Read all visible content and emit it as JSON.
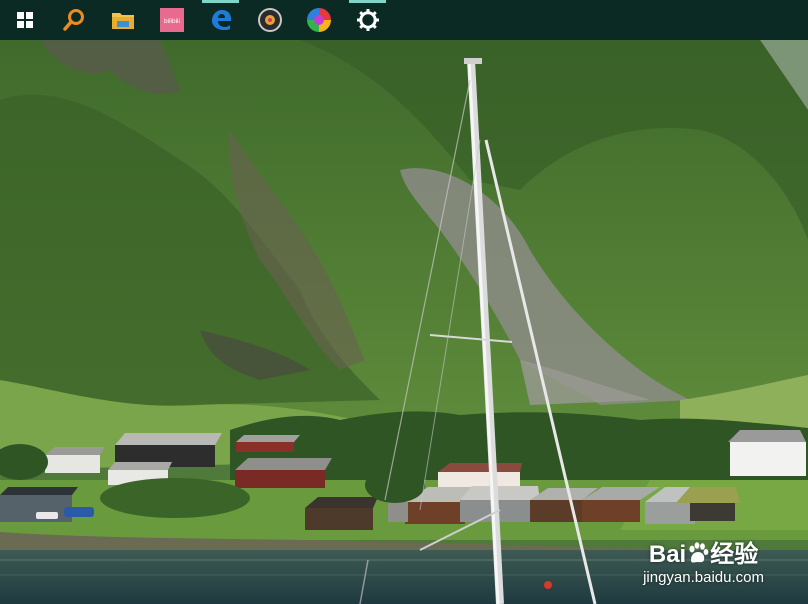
{
  "taskbar": {
    "background": "#0c2a24",
    "items": [
      {
        "icon": "windows-start-icon",
        "active": false
      },
      {
        "icon": "search-icon",
        "color": "#f08a1c",
        "active": false
      },
      {
        "icon": "file-explorer-icon",
        "color": "#f2c14e",
        "active": false
      },
      {
        "icon": "bilibili-icon",
        "color": "#e86a8e",
        "active": false
      },
      {
        "icon": "edge-icon",
        "color": "#1f7bd8",
        "active": true
      },
      {
        "icon": "music-disc-icon",
        "active": false
      },
      {
        "icon": "color-picker-icon",
        "active": false
      },
      {
        "icon": "settings-gear-icon",
        "active": true
      }
    ],
    "bilibili_text": "bilibili"
  },
  "wallpaper": {
    "subject": "fjord village with sailboat mast"
  },
  "watermark": {
    "brand_left": "Bai",
    "brand_right": "经验",
    "url": "jingyan.baidu.com"
  }
}
